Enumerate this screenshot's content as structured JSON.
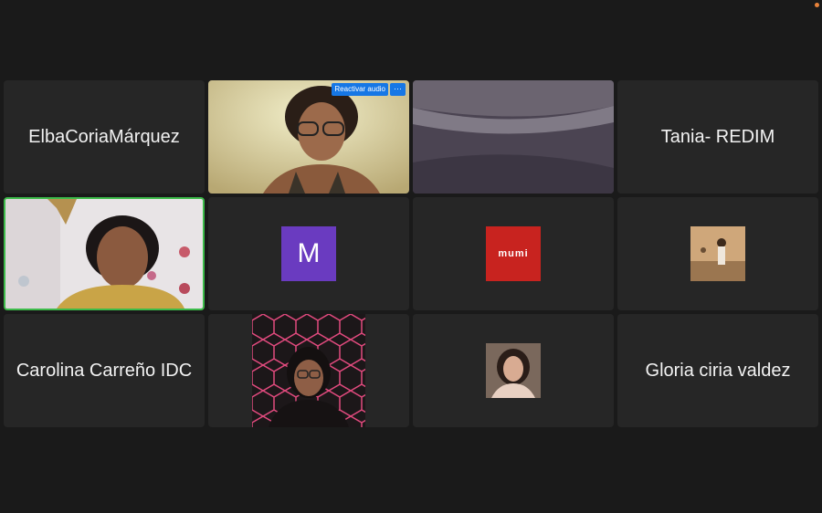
{
  "participants": [
    {
      "name": "ElbaCoriaMárquez"
    },
    {
      "name": "",
      "unmute_label": "Reactivar audio",
      "more_label": "···"
    },
    {
      "name": ""
    },
    {
      "name": "Tania- REDIM"
    },
    {
      "name": ""
    },
    {
      "name": "",
      "avatar_letter": "M"
    },
    {
      "name": "",
      "avatar_logo_text": "mumi"
    },
    {
      "name": ""
    },
    {
      "name": "Carolina Carreño IDC"
    },
    {
      "name": ""
    },
    {
      "name": ""
    },
    {
      "name": "Gloria ciria valdez"
    }
  ],
  "colors": {
    "background": "#1a1a1a",
    "tile": "#262626",
    "active_speaker_border": "#3dbb4a",
    "avatar_purple": "#6a3bc0",
    "avatar_red": "#c8231f",
    "button_blue": "#1677e5"
  }
}
